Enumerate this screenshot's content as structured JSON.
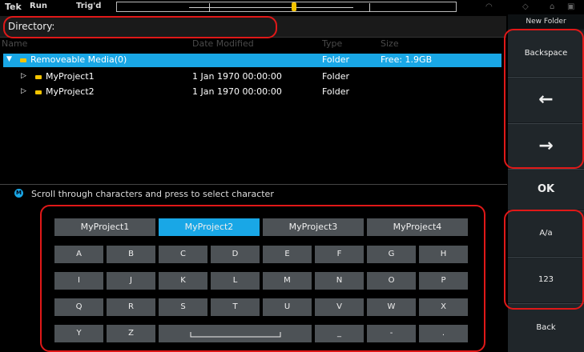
{
  "status": {
    "brand": "Tek",
    "run": "Run",
    "trig": "Trig'd"
  },
  "directory": {
    "label": "Directory:"
  },
  "columns": [
    "Name",
    "Date Modified",
    "Type",
    "Size"
  ],
  "files": [
    {
      "name": "Removeable Media(0)",
      "date": "",
      "type": "Folder",
      "size": "Free: 1.9GB",
      "expanded": true,
      "selected": true
    },
    {
      "name": "MyProject1",
      "date": "1 Jan 1970 00:00:00",
      "type": "Folder",
      "size": "",
      "expanded": false,
      "selected": false
    },
    {
      "name": "MyProject2",
      "date": "1 Jan 1970 00:00:00",
      "type": "Folder",
      "size": "",
      "expanded": false,
      "selected": false
    }
  ],
  "hint": {
    "icon": "M",
    "text": "Scroll through characters and press to select character"
  },
  "keyboard": {
    "suggestions": [
      "MyProject1",
      "MyProject2",
      "MyProject3",
      "MyProject4"
    ],
    "selected_suggestion": 1,
    "rows": [
      [
        "A",
        "B",
        "C",
        "D",
        "E",
        "F",
        "G",
        "H"
      ],
      [
        "I",
        "J",
        "K",
        "L",
        "M",
        "N",
        "O",
        "P"
      ],
      [
        "Q",
        "R",
        "S",
        "T",
        "U",
        "V",
        "W",
        "X"
      ],
      [
        "Y",
        "Z",
        "",
        "",
        "",
        "_",
        "-",
        "."
      ]
    ]
  },
  "side_menu": {
    "title": "New Folder",
    "backspace": "Backspace",
    "left": "←",
    "right": "→",
    "ok": "OK",
    "case": "A/a",
    "numbers": "123",
    "back": "Back"
  },
  "colors": {
    "accent": "#19a7e6",
    "folder": "#f5c400",
    "annotation": "#e01818",
    "key": "#4d5256"
  }
}
